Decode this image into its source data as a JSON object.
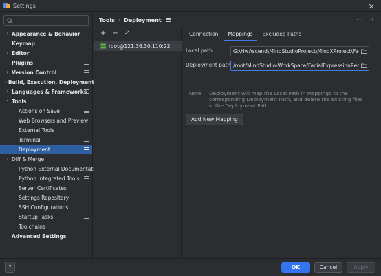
{
  "window": {
    "title": "Settings"
  },
  "search": {
    "placeholder": "",
    "value": ""
  },
  "sidebar": {
    "items": [
      {
        "label": "Appearance & Behavior",
        "bold": true,
        "chevron": "right",
        "indent": 0,
        "badge": false
      },
      {
        "label": "Keymap",
        "bold": true,
        "chevron": "",
        "indent": 0,
        "badge": false
      },
      {
        "label": "Editor",
        "bold": true,
        "chevron": "right",
        "indent": 0,
        "badge": false
      },
      {
        "label": "Plugins",
        "bold": true,
        "chevron": "",
        "indent": 0,
        "badge": true
      },
      {
        "label": "Version Control",
        "bold": true,
        "chevron": "right",
        "indent": 0,
        "badge": true
      },
      {
        "label": "Build, Execution, Deployment",
        "bold": true,
        "chevron": "right",
        "indent": 0,
        "badge": false
      },
      {
        "label": "Languages & Frameworks",
        "bold": true,
        "chevron": "right",
        "indent": 0,
        "badge": true
      },
      {
        "label": "Tools",
        "bold": true,
        "chevron": "down",
        "indent": 0,
        "badge": false
      },
      {
        "label": "Actions on Save",
        "bold": false,
        "chevron": "",
        "indent": 1,
        "badge": true
      },
      {
        "label": "Web Browsers and Preview",
        "bold": false,
        "chevron": "",
        "indent": 1,
        "badge": false
      },
      {
        "label": "External Tools",
        "bold": false,
        "chevron": "",
        "indent": 1,
        "badge": false
      },
      {
        "label": "Terminal",
        "bold": false,
        "chevron": "",
        "indent": 1,
        "badge": true
      },
      {
        "label": "Deployment",
        "bold": false,
        "chevron": "",
        "indent": 1,
        "badge": true,
        "selected": true
      },
      {
        "label": "Diff & Merge",
        "bold": false,
        "chevron": "right",
        "indent": 1,
        "badge": false
      },
      {
        "label": "Python External Documentation",
        "bold": false,
        "chevron": "",
        "indent": 1,
        "badge": false
      },
      {
        "label": "Python Integrated Tools",
        "bold": false,
        "chevron": "",
        "indent": 1,
        "badge": true
      },
      {
        "label": "Server Certificates",
        "bold": false,
        "chevron": "",
        "indent": 1,
        "badge": false
      },
      {
        "label": "Settings Repository",
        "bold": false,
        "chevron": "",
        "indent": 1,
        "badge": false
      },
      {
        "label": "SSH Configurations",
        "bold": false,
        "chevron": "",
        "indent": 1,
        "badge": false
      },
      {
        "label": "Startup Tasks",
        "bold": false,
        "chevron": "",
        "indent": 1,
        "badge": true
      },
      {
        "label": "Toolchains",
        "bold": false,
        "chevron": "",
        "indent": 1,
        "badge": false
      },
      {
        "label": "Advanced Settings",
        "bold": true,
        "chevron": "",
        "indent": 0,
        "badge": false
      }
    ]
  },
  "breadcrumb": {
    "parent": "Tools",
    "separator": "›",
    "current": "Deployment"
  },
  "server_toolbar": {
    "add": "+",
    "remove": "−",
    "check": "✓"
  },
  "servers": [
    {
      "name": "root@121.36.30.110:22"
    }
  ],
  "tabs": [
    {
      "label": "Connection",
      "active": false
    },
    {
      "label": "Mappings",
      "active": true
    },
    {
      "label": "Excluded Paths",
      "active": false
    }
  ],
  "mappings": {
    "local_label": "Local path:",
    "local_value": "G:\\HwAscend\\MindStudioProject\\MindXProject\\FacialExpressionRecognition",
    "deploy_label": "Deployment path:",
    "deploy_value": "/root/MindStudio-WorkSpace/FacialExpressionRecognition",
    "note_label": "Note:",
    "note_text": "Deployment will map the Local Path in Mappings to the corresponding Deployment Path, and delete the existing files in the Deployment Path.",
    "add_button": "Add New Mapping"
  },
  "footer": {
    "help": "?",
    "ok": "OK",
    "cancel": "Cancel",
    "apply": "Apply"
  },
  "colors": {
    "accent": "#3574f0",
    "selection": "#2e5fa3",
    "background": "#2b2d30",
    "server_icon": "#62b543"
  }
}
